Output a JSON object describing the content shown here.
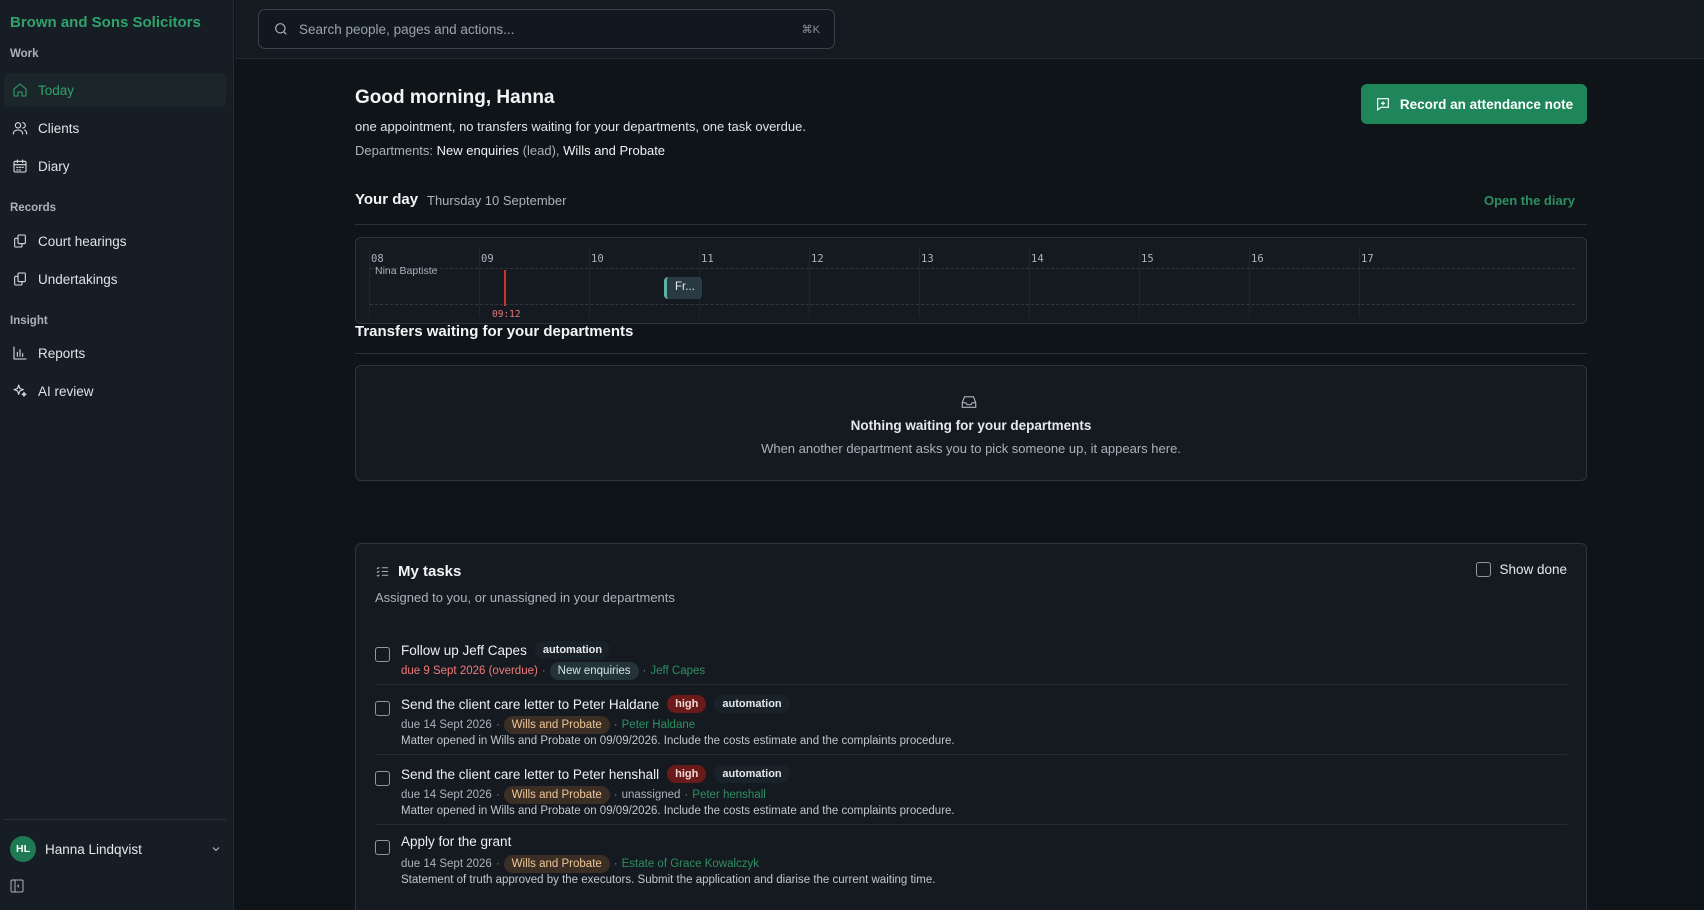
{
  "brand": "Brown and Sons Solicitors",
  "sidebar": {
    "sections": [
      {
        "label": "Work"
      },
      {
        "label": "Records"
      },
      {
        "label": "Insight"
      }
    ],
    "items": [
      {
        "label": "Today",
        "icon": "home-icon"
      },
      {
        "label": "Clients",
        "icon": "users-icon"
      },
      {
        "label": "Diary",
        "icon": "calendar-icon"
      },
      {
        "label": "Court hearings",
        "icon": "documents-icon"
      },
      {
        "label": "Undertakings",
        "icon": "documents-icon"
      },
      {
        "label": "Reports",
        "icon": "bar-chart-icon"
      },
      {
        "label": "AI review",
        "icon": "sparkles-icon"
      }
    ],
    "user": {
      "initials": "HL",
      "name": "Hanna Lindqvist"
    }
  },
  "search": {
    "placeholder": "Search people, pages and actions...",
    "shortcut": "⌘K"
  },
  "header": {
    "greeting": "Good morning, Hanna",
    "summary": "one appointment, no transfers waiting for your departments, one task overdue.",
    "departments_label": "Departments:",
    "dept_1": "New enquiries",
    "dept_1_note": "(lead),",
    "dept_2": "Wills and Probate",
    "record_button": "Record an attendance note"
  },
  "your_day": {
    "title": "Your day",
    "date": "Thursday 10 September",
    "open_diary": "Open the diary",
    "hours": [
      "08",
      "09",
      "10",
      "11",
      "12",
      "13",
      "14",
      "15",
      "16",
      "17"
    ],
    "person": "Nina Baptiste",
    "now_label": "09:12",
    "appointment_label": "Fr..."
  },
  "transfers": {
    "title": "Transfers waiting for your departments",
    "empty_title": "Nothing waiting for your departments",
    "empty_sub": "When another department asks you to pick someone up, it appears here."
  },
  "tasks": {
    "title": "My tasks",
    "subtitle": "Assigned to you, or unassigned in your departments",
    "show_done": "Show done",
    "items": [
      {
        "title": "Follow up Jeff Capes",
        "tags": [
          "automation"
        ],
        "due": "due 9 Sept 2026 (overdue)",
        "dept": "New enquiries",
        "assignee": "",
        "client": "Jeff Capes",
        "note": ""
      },
      {
        "title": "Send the client care letter to Peter Haldane",
        "tags": [
          "high",
          "automation"
        ],
        "due": "due 14 Sept 2026",
        "dept": "Wills and Probate",
        "assignee": "",
        "client": "Peter Haldane",
        "note": "Matter opened in Wills and Probate on 09/09/2026. Include the costs estimate and the complaints procedure."
      },
      {
        "title": "Send the client care letter to Peter henshall",
        "tags": [
          "high",
          "automation"
        ],
        "due": "due 14 Sept 2026",
        "dept": "Wills and Probate",
        "assignee": "unassigned",
        "client": "Peter henshall",
        "note": "Matter opened in Wills and Probate on 09/09/2026. Include the costs estimate and the complaints procedure."
      },
      {
        "title": "Apply for the grant",
        "tags": [],
        "due": "due 14 Sept 2026",
        "dept": "Wills and Probate",
        "assignee": "",
        "client": "Estate of Grace Kowalczyk",
        "note": "Statement of truth approved by the executors. Submit the application and diarise the current waiting time."
      }
    ]
  },
  "colors": {
    "accent": "#2fa36b",
    "button": "#1e8659",
    "overdue": "#f07a7a",
    "high_badge": "#6b1a1a",
    "now_line": "#d0312d"
  }
}
